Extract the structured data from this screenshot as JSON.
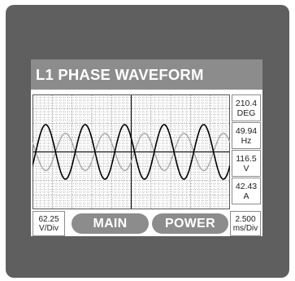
{
  "screen": {
    "title": "L1 PHASE WAVEFORM"
  },
  "readouts": [
    {
      "value": "210.4",
      "unit": "DEG"
    },
    {
      "value": "49.94",
      "unit": "Hz"
    },
    {
      "value": "116.5",
      "unit": "V"
    },
    {
      "value": "42.43",
      "unit": "A"
    }
  ],
  "scales": {
    "volts": {
      "value": "62.25",
      "unit": "V/Div"
    },
    "time": {
      "value": "2.500",
      "unit": "ms/Div"
    }
  },
  "buttons": {
    "main_label": "MAIN",
    "power_label": "POWER"
  },
  "colors": {
    "bezel": "#5f5f5f",
    "panel_gray": "#8c8c8c",
    "grid": "#9a9a9a",
    "voltage_trace": "#000000",
    "current_trace": "#a8a8a8"
  },
  "waveform": {
    "cycles_shown": 5,
    "voltage_amplitude_div": 1.9,
    "current_amplitude_div": 1.3,
    "phase_shift_deg": 210.4
  }
}
